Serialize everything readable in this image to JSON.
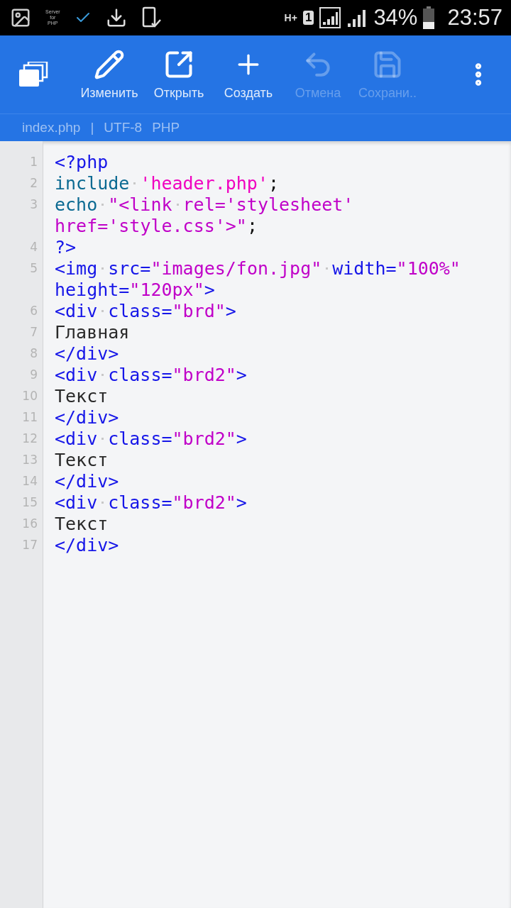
{
  "status_bar": {
    "notification_text": [
      "Server",
      "for",
      "PHP"
    ],
    "network": "H+",
    "sim": "1",
    "battery": "34%",
    "time": "23:57"
  },
  "toolbar": {
    "actions": [
      {
        "label": "Изменить",
        "kind": "edit",
        "disabled": false
      },
      {
        "label": "Открыть",
        "kind": "open",
        "disabled": false
      },
      {
        "label": "Создать",
        "kind": "create",
        "disabled": false
      },
      {
        "label": "Отмена",
        "kind": "undo",
        "disabled": true
      },
      {
        "label": "Сохрани..",
        "kind": "save",
        "disabled": true
      }
    ]
  },
  "file_info": {
    "file": "index.php",
    "separator": "|",
    "encoding": "UTF-8",
    "language": "PHP"
  },
  "editor": {
    "lines": [
      {
        "number": "1",
        "tokens": [
          {
            "kind": "tag",
            "text": "<?php"
          }
        ]
      },
      {
        "number": "2",
        "tokens": [
          {
            "kind": "keyword",
            "text": "include"
          },
          {
            "kind": "space"
          },
          {
            "kind": "literal",
            "text": "'header.php'"
          },
          {
            "kind": "punct",
            "text": ";"
          }
        ]
      },
      {
        "number": "3",
        "tokens": [
          {
            "kind": "keyword",
            "text": "echo"
          },
          {
            "kind": "space"
          },
          {
            "kind": "string",
            "text": "\"<link"
          },
          {
            "kind": "space"
          },
          {
            "kind": "string",
            "text": "rel='stylesheet'"
          },
          {
            "kind": "wrap"
          },
          {
            "kind": "string",
            "text": "href='style.css'>\""
          },
          {
            "kind": "punct",
            "text": ";"
          }
        ]
      },
      {
        "number": "4",
        "tokens": [
          {
            "kind": "tag",
            "text": "?>"
          }
        ]
      },
      {
        "number": "5",
        "tokens": [
          {
            "kind": "tag",
            "text": "<img"
          },
          {
            "kind": "space"
          },
          {
            "kind": "tag",
            "text": "src="
          },
          {
            "kind": "string",
            "text": "\"images/fon.jpg\""
          },
          {
            "kind": "space"
          },
          {
            "kind": "tag",
            "text": "width="
          },
          {
            "kind": "string",
            "text": "\"100%\""
          },
          {
            "kind": "wrap"
          },
          {
            "kind": "tag",
            "text": "height="
          },
          {
            "kind": "string",
            "text": "\"120px\""
          },
          {
            "kind": "tag",
            "text": ">"
          }
        ]
      },
      {
        "number": "6",
        "tokens": [
          {
            "kind": "tag",
            "text": "<div"
          },
          {
            "kind": "space"
          },
          {
            "kind": "tag",
            "text": "class="
          },
          {
            "kind": "string",
            "text": "\"brd\""
          },
          {
            "kind": "tag",
            "text": ">"
          }
        ]
      },
      {
        "number": "7",
        "tokens": [
          {
            "kind": "text",
            "text": "Главная"
          }
        ]
      },
      {
        "number": "8",
        "tokens": [
          {
            "kind": "tag",
            "text": "</div>"
          }
        ]
      },
      {
        "number": "9",
        "tokens": [
          {
            "kind": "tag",
            "text": "<div"
          },
          {
            "kind": "space"
          },
          {
            "kind": "tag",
            "text": "class="
          },
          {
            "kind": "string",
            "text": "\"brd2\""
          },
          {
            "kind": "tag",
            "text": ">"
          }
        ]
      },
      {
        "number": "10",
        "tokens": [
          {
            "kind": "text",
            "text": "Текст"
          }
        ]
      },
      {
        "number": "11",
        "tokens": [
          {
            "kind": "tag",
            "text": "</div>"
          }
        ]
      },
      {
        "number": "12",
        "tokens": [
          {
            "kind": "tag",
            "text": "<div"
          },
          {
            "kind": "space"
          },
          {
            "kind": "tag",
            "text": "class="
          },
          {
            "kind": "string",
            "text": "\"brd2\""
          },
          {
            "kind": "tag",
            "text": ">"
          }
        ]
      },
      {
        "number": "13",
        "tokens": [
          {
            "kind": "text",
            "text": "Текст"
          }
        ]
      },
      {
        "number": "14",
        "tokens": [
          {
            "kind": "tag",
            "text": "</div>"
          }
        ]
      },
      {
        "number": "15",
        "tokens": [
          {
            "kind": "tag",
            "text": "<div"
          },
          {
            "kind": "space"
          },
          {
            "kind": "tag",
            "text": "class="
          },
          {
            "kind": "string",
            "text": "\"brd2\""
          },
          {
            "kind": "tag",
            "text": ">"
          }
        ]
      },
      {
        "number": "16",
        "tokens": [
          {
            "kind": "text",
            "text": "Текст"
          }
        ]
      },
      {
        "number": "17",
        "tokens": [
          {
            "kind": "tag",
            "text": "</div>"
          }
        ]
      }
    ]
  }
}
